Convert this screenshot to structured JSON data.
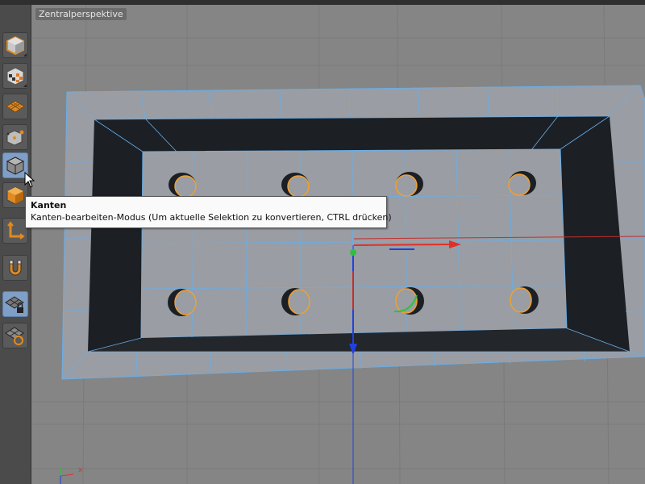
{
  "viewport": {
    "label": "Zentralperspektive",
    "axis_x_label": "x"
  },
  "toolbar": {
    "tools": [
      {
        "icon": "cube-object-mode-icon",
        "active": false
      },
      {
        "icon": "checker-cube-texture-mode-icon",
        "active": false
      },
      {
        "icon": "workplane-grid-icon",
        "active": false
      },
      {
        "icon": "points-mode-icon",
        "active": false
      },
      {
        "icon": "edges-mode-icon",
        "active": true
      },
      {
        "icon": "polygons-mode-icon",
        "active": false
      },
      {
        "icon": "axis-mode-icon",
        "active": false
      },
      {
        "icon": "snapping-magnet-icon",
        "active": false
      },
      {
        "icon": "locked-workplane-icon",
        "active": true
      },
      {
        "icon": "rotating-grid-icon",
        "active": false
      }
    ]
  },
  "tooltip": {
    "title": "Kanten",
    "description": "Kanten-bearbeiten-Modus (Um aktuelle Selektion zu konvertieren, CTRL drücken)"
  },
  "colors": {
    "viewport_bg": "#858585",
    "mesh_surface": "#9a9da3",
    "mesh_edges": "#6aaee8",
    "inner_wall": "#1c1f24",
    "axis_x": "#e0302a",
    "axis_y": "#30c040",
    "axis_z": "#2040e0",
    "selection_orange": "#f0a030",
    "active_tool": "#7f9fc6"
  }
}
